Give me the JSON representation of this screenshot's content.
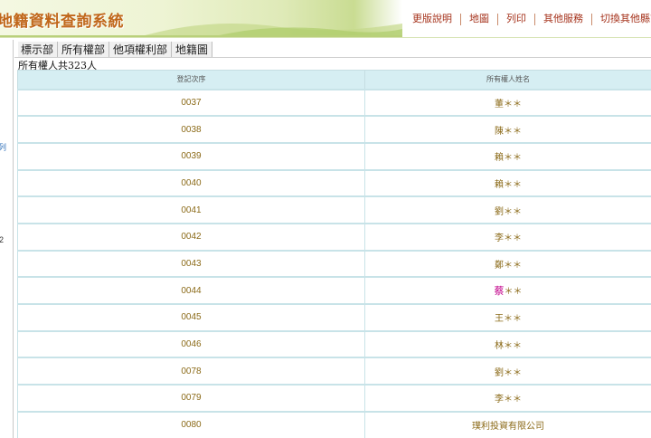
{
  "header": {
    "title": "地籍資料查詢系統",
    "nav": [
      "更版說明",
      "地圖",
      "列印",
      "其他服務",
      "切換其他縣市"
    ]
  },
  "sidebar": {
    "fragment_1": "列",
    "fragment_2": "2"
  },
  "tabs": [
    "標示部",
    "所有權部",
    "他項權利部",
    "地籍圖"
  ],
  "summary": "所有權人共323人",
  "table": {
    "columns": [
      "登記次序",
      "所有權人姓名"
    ],
    "rows": [
      {
        "order": "0037",
        "owner": "董＊＊"
      },
      {
        "order": "0038",
        "owner": "陳＊＊"
      },
      {
        "order": "0039",
        "owner": "賴＊＊"
      },
      {
        "order": "0040",
        "owner": "賴＊＊"
      },
      {
        "order": "0041",
        "owner": "劉＊＊"
      },
      {
        "order": "0042",
        "owner": "李＊＊"
      },
      {
        "order": "0043",
        "owner": "鄭＊＊"
      },
      {
        "order": "0044",
        "owner_highlight": "蔡",
        "owner_rest": "＊＊"
      },
      {
        "order": "0045",
        "owner": "王＊＊"
      },
      {
        "order": "0046",
        "owner": "林＊＊"
      },
      {
        "order": "0078",
        "owner": "劉＊＊"
      },
      {
        "order": "0079",
        "owner": "李＊＊"
      },
      {
        "order": "0080",
        "owner": "璞利投資有限公司"
      }
    ]
  },
  "colors": {
    "title": "#c0671a",
    "nav_link": "#a5321b",
    "table_header_bg": "#d6eef3",
    "cell_text": "#8b6a18",
    "highlight": "#c2008a"
  }
}
